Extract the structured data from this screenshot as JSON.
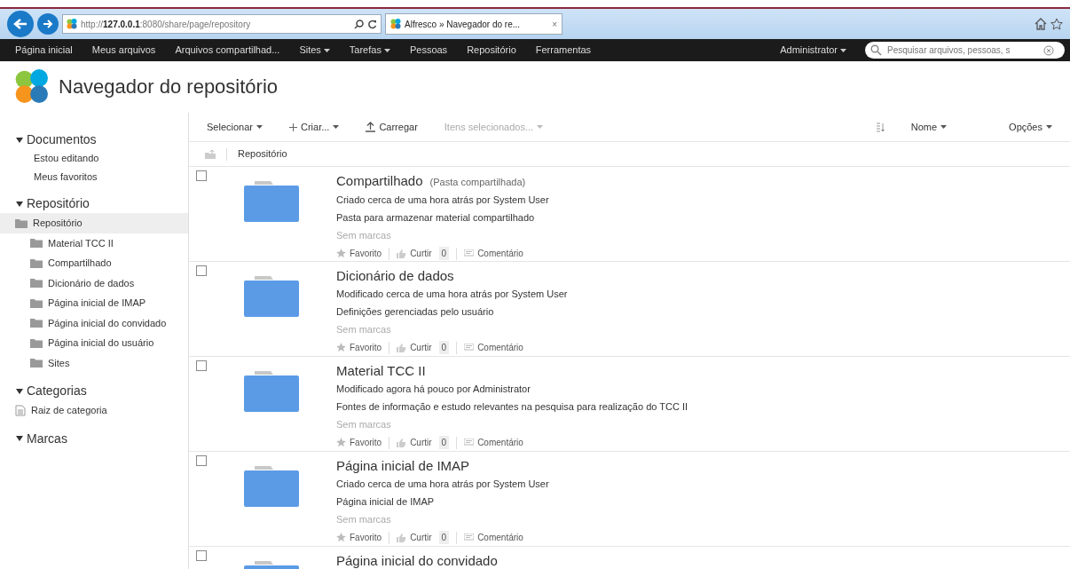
{
  "browser": {
    "url_prefix": "http://",
    "url_host": "127.0.0.1",
    "url_rest": ":8080/share/page/repository",
    "tab_title": "Alfresco » Navegador do re...",
    "tab_close": "×"
  },
  "nav": {
    "items": [
      {
        "label": "Página inicial",
        "dropdown": false
      },
      {
        "label": "Meus arquivos",
        "dropdown": false
      },
      {
        "label": "Arquivos compartilhad...",
        "dropdown": false
      },
      {
        "label": "Sites",
        "dropdown": true
      },
      {
        "label": "Tarefas",
        "dropdown": true
      },
      {
        "label": "Pessoas",
        "dropdown": false
      },
      {
        "label": "Repositório",
        "dropdown": false
      },
      {
        "label": "Ferramentas",
        "dropdown": false
      }
    ],
    "user": "Administrator",
    "search_placeholder": "Pesquisar arquivos, pessoas, s"
  },
  "header": {
    "title": "Navegador do repositório"
  },
  "sidebar": [
    {
      "title": "Documentos",
      "items": [
        {
          "label": "Estou editando",
          "kind": "link"
        },
        {
          "label": "Meus favoritos",
          "kind": "link"
        }
      ]
    },
    {
      "title": "Repositório",
      "items": [
        {
          "label": "Repositório",
          "kind": "folder",
          "selected": true,
          "children": [
            {
              "label": "Material TCC II",
              "kind": "folder",
              "selected": false
            },
            {
              "label": "Compartilhado",
              "kind": "folder",
              "selected": false
            },
            {
              "label": "Dicionário de dados",
              "kind": "folder",
              "selected": false
            },
            {
              "label": "Página inicial de IMAP",
              "kind": "folder",
              "selected": false
            },
            {
              "label": "Página inicial do convidado",
              "kind": "folder",
              "selected": false
            },
            {
              "label": "Página inicial do usuário",
              "kind": "folder",
              "selected": false
            },
            {
              "label": "Sites",
              "kind": "folder",
              "selected": false
            }
          ]
        }
      ]
    },
    {
      "title": "Categorias",
      "items": [
        {
          "label": "Raiz de categoria",
          "kind": "category"
        }
      ]
    },
    {
      "title": "Marcas"
    }
  ],
  "toolbar": {
    "items": [
      {
        "label": "Selecionar",
        "kind": "menu",
        "disabled": false
      },
      {
        "label": "Criar...",
        "kind": "create",
        "disabled": false
      },
      {
        "label": "Carregar",
        "kind": "upload",
        "disabled": false
      },
      {
        "label": "Itens selecionados...",
        "kind": "menu",
        "disabled": true
      }
    ],
    "sort": "Nome",
    "options": "Opções"
  },
  "breadcrumb": "Repositório",
  "rows": [
    {
      "title": "Compartilhado",
      "subtitle": "(Pasta compartilhada)",
      "meta": "Criado cerca de uma hora atrás por System User",
      "description": "Pasta para armazenar material compartilhado",
      "tags": "Sem marcas",
      "checked": false,
      "favorite": "Favorito",
      "like": "Curtir",
      "likes": "0",
      "comment": "Comentário"
    },
    {
      "title": "Dicionário de dados",
      "meta": "Modificado cerca de uma hora atrás por System User",
      "description": "Definições gerenciadas pelo usuário",
      "tags": "Sem marcas",
      "checked": false,
      "favorite": "Favorito",
      "like": "Curtir",
      "likes": "0",
      "comment": "Comentário"
    },
    {
      "title": "Material TCC II",
      "meta": "Modificado agora há pouco por Administrator",
      "description": "Fontes de informação e estudo relevantes na pesquisa para realização do TCC II",
      "tags": "Sem marcas",
      "checked": false,
      "favorite": "Favorito",
      "like": "Curtir",
      "likes": "0",
      "comment": "Comentário"
    },
    {
      "title": "Página inicial de IMAP",
      "meta": "Criado cerca de uma hora atrás por System User",
      "description": "Página inicial de IMAP",
      "tags": "Sem marcas",
      "checked": false,
      "favorite": "Favorito",
      "like": "Curtir",
      "likes": "0",
      "comment": "Comentário"
    },
    {
      "title": "Página inicial do convidado",
      "checked": false
    }
  ]
}
